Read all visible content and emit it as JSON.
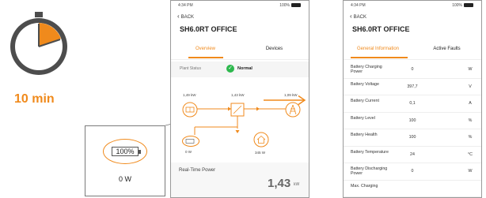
{
  "duration": "10 min",
  "zoom": {
    "battery_level": "100%",
    "power": "0 W"
  },
  "phone_status": {
    "time": "4:34 PM",
    "battery": "100%"
  },
  "overview_screen": {
    "back": "BACK",
    "title": "SH6.0RT OFFICE",
    "tabs": [
      "Overview",
      "Devices"
    ],
    "active_tab": 0,
    "plant_status_label": "Plant Status",
    "plant_status_value": "Normal",
    "flow": {
      "pv_power": "1,49 kW",
      "inverter_power": "1,43 kW",
      "grid_power": "1,09 kW",
      "battery_power": "0 W",
      "load_power": "345 W"
    },
    "realtime_label": "Real-Time Power",
    "realtime_value": "1,43",
    "realtime_unit": "kW"
  },
  "detail_screen": {
    "back": "BACK",
    "title": "SH6.0RT OFFICE",
    "tabs": [
      "General Information",
      "Active Faults"
    ],
    "active_tab": 0,
    "rows": [
      {
        "name": "Battery Charging Power",
        "value": "0",
        "unit": "W"
      },
      {
        "name": "Battery Voltage",
        "value": "397,7",
        "unit": "V"
      },
      {
        "name": "Battery Current",
        "value": "0,1",
        "unit": "A"
      },
      {
        "name": "Battery Level",
        "value": "100",
        "unit": "%"
      },
      {
        "name": "Battery Health",
        "value": "100",
        "unit": "%"
      },
      {
        "name": "Battery Temperature",
        "value": "24",
        "unit": "°C"
      },
      {
        "name": "Battery Discharging Power",
        "value": "0",
        "unit": "W"
      },
      {
        "name": "Max. Charging",
        "value": "",
        "unit": ""
      }
    ]
  },
  "colors": {
    "accent": "#f08a1c",
    "timer_face": "#4d4d4d",
    "ok": "#2db84d"
  }
}
